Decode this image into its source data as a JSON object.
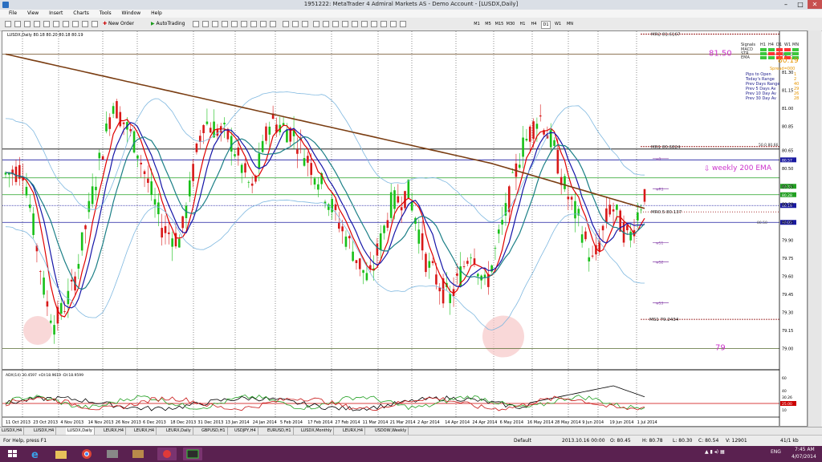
{
  "window": {
    "title": "1951222: MetaTrader 4 Admiral Markets AS - Demo Account - [LUSDX,Daily]"
  },
  "menu": [
    "File",
    "View",
    "Insert",
    "Charts",
    "Tools",
    "Window",
    "Help"
  ],
  "toolbar": {
    "new_order": "New Order",
    "autotrading": "AutoTrading",
    "timeframes": [
      "M1",
      "M5",
      "M15",
      "M30",
      "H1",
      "H4",
      "D1",
      "W1",
      "MN"
    ]
  },
  "chart": {
    "header": "LUSDX,Daily  80.18 80.20 80.18 80.19",
    "price_ticks": [
      "81.45",
      "81.30",
      "81.15",
      "81.00",
      "80.85",
      "80.65",
      "80.50",
      "80.35",
      "80.20",
      "80.05",
      "79.90",
      "79.75",
      "79.60",
      "79.45",
      "79.30",
      "79.15",
      "79.00"
    ],
    "date_ticks": [
      "11 Oct 2013",
      "23 Oct 2013",
      "4 Nov 2013",
      "14 Nov 2013",
      "26 Nov 2013",
      "6 Dec 2013",
      "18 Dec 2013",
      "31 Dec 2013",
      "13 Jan 2014",
      "24 Jan 2014",
      "5 Feb 2014",
      "17 Feb 2014",
      "27 Feb 2014",
      "11 Mar 2014",
      "21 Mar 2014",
      "2 Apr 2014",
      "14 Apr 2014",
      "24 Apr 2014",
      "6 May 2014",
      "16 May 2014",
      "28 May 2014",
      "9 Jun 2014",
      "19 Jun 2014",
      "1 Jul 2014"
    ],
    "labels": {
      "mr2": "MR2  81.6167",
      "mr1": "MR1  80.6824",
      "ms1": "MS1  79.2434",
      "level_8150": "81.50",
      "level_79": "79",
      "weekly_ema": "weekly 200 EMA",
      "fib50": "50.0  80.66",
      "mr05": "MR0.5  80.137",
      "w2": "w2",
      "wr1": "wR1",
      "ws1": "wS1",
      "ws2": "wS2",
      "ws3": "wS3",
      "current_price": "80.19",
      "fib_right": "80.50"
    },
    "right_tags": [
      "80.57",
      "80.35",
      "80.28",
      "80.19",
      "80.05"
    ],
    "signal_panel": {
      "header": "Signals",
      "timeframes": [
        "H1",
        "H4",
        "D1",
        "W1",
        "MN"
      ],
      "indicators": [
        "MACD",
        "STR",
        "EMA"
      ],
      "price": "80.19",
      "spread": "Spread=000",
      "rows": [
        {
          "label": "Pips to Open",
          "value": "1"
        },
        {
          "label": "Today's Range",
          "value": "2"
        },
        {
          "label": "Prev Days Range",
          "value": "40"
        },
        {
          "label": "Prev 5 Days Av",
          "value": "29"
        },
        {
          "label": "Prev 10 Day Av",
          "value": "26"
        },
        {
          "label": "Prev 30 Day Av",
          "value": "28"
        }
      ]
    }
  },
  "adx": {
    "header": "ADX(14) 30.4597 +DI:18.9619 -DI:18.9599",
    "ticks": [
      "60",
      "40",
      "30.26",
      "20",
      "10"
    ],
    "ticks_right": [
      "25.00"
    ]
  },
  "tabs": [
    "LUSDX,H4",
    "LUSDX,H4",
    "LUSDX,Daily",
    "LEURX,H4",
    "LEURX,H4",
    "LEURX,Daily",
    "GBPUSD,H1",
    "USDJPY,H4",
    "EURUSD,H1",
    "LUSDX,Monthly",
    "LEURX,H4",
    "USDOW,Weekly"
  ],
  "status": {
    "help": "For Help, press F1",
    "profile": "Default",
    "datetime": "2013.10.16 00:00",
    "open": "O: 80.45",
    "high": "H: 80.78",
    "low": "L: 80.30",
    "close": "C: 80.54",
    "volume": "V: 12901",
    "traffic": "41/1 kb"
  },
  "taskbar": {
    "time": "7:45 AM",
    "date": "4/07/2014",
    "lang": "ENG"
  },
  "colors": {
    "sma_red": "#e00000",
    "ema_blue": "#1515a8",
    "ema_teal": "#1b7f86",
    "ema200": "#7a3d12",
    "bull": "#18c018",
    "bear": "#d81818",
    "magenta": "#cc33cc"
  }
}
